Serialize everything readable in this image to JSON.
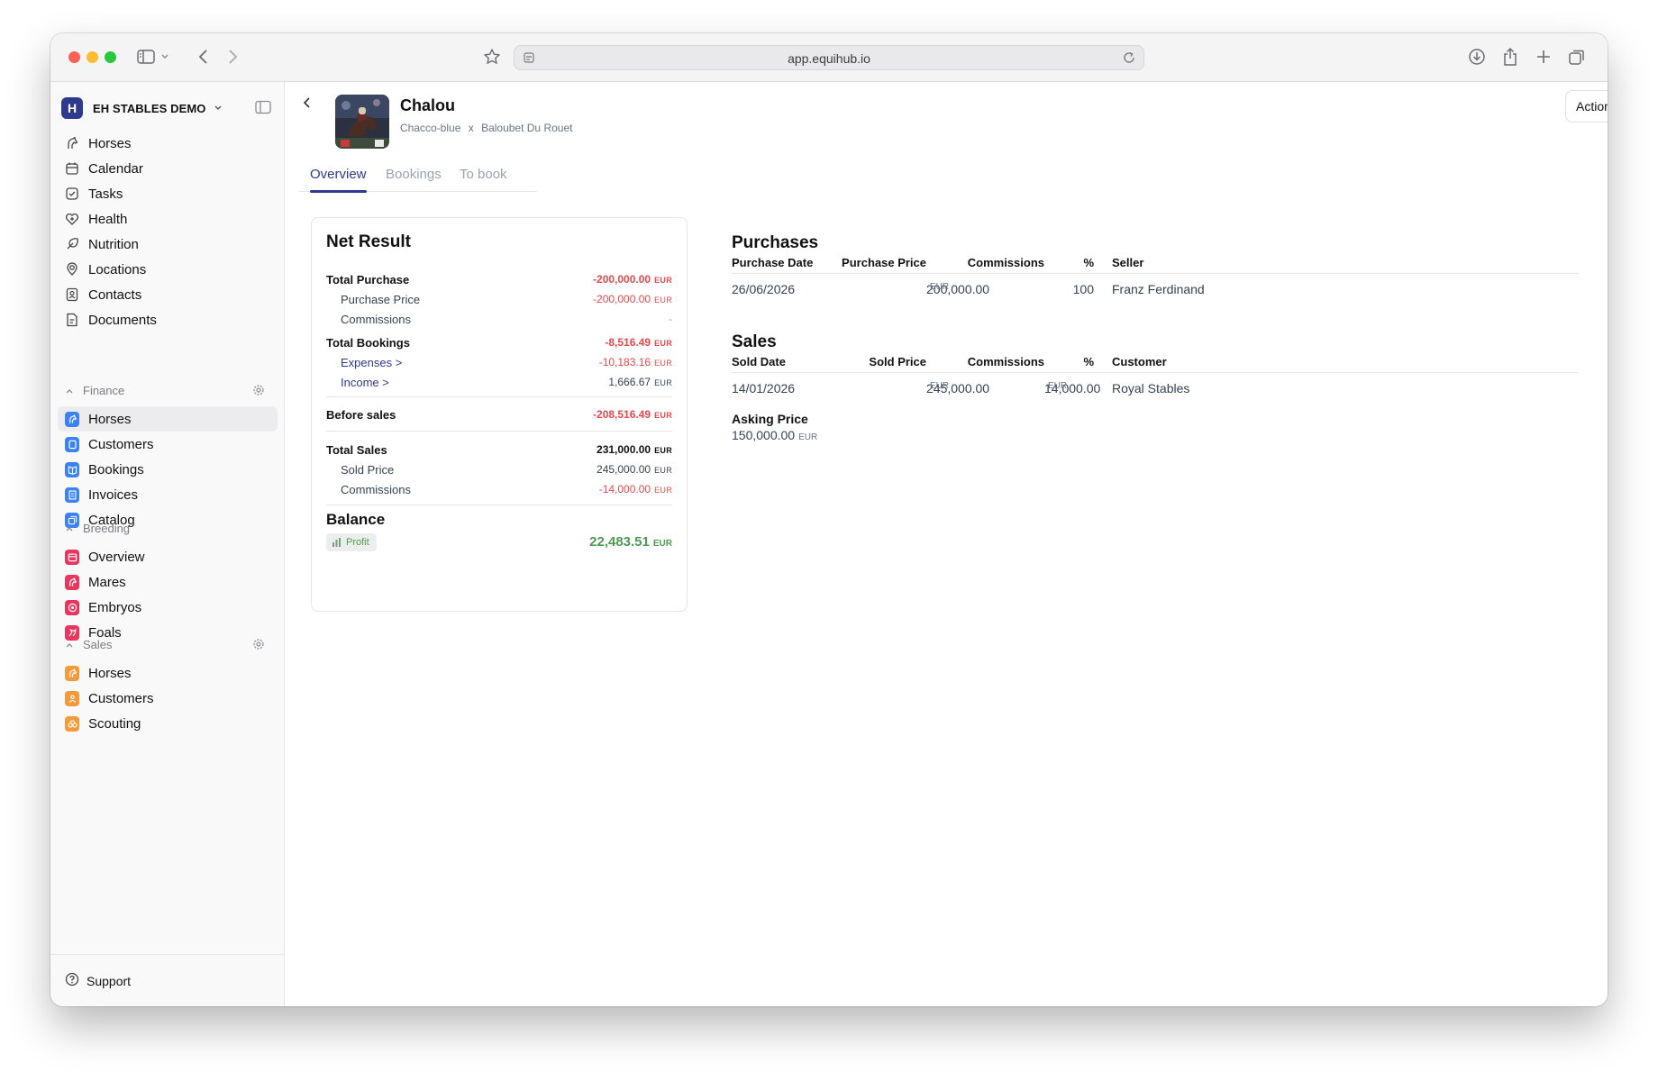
{
  "browser": {
    "url": "app.equihub.io"
  },
  "sidebar": {
    "workspace": "EH STABLES DEMO",
    "workspace_logo": "H",
    "main_items": [
      {
        "label": "Horses",
        "icon": "horse-icon"
      },
      {
        "label": "Calendar",
        "icon": "calendar-icon"
      },
      {
        "label": "Tasks",
        "icon": "checkbox-icon"
      },
      {
        "label": "Health",
        "icon": "health-icon"
      },
      {
        "label": "Nutrition",
        "icon": "nutrition-icon"
      },
      {
        "label": "Locations",
        "icon": "location-icon"
      },
      {
        "label": "Contacts",
        "icon": "contacts-icon"
      },
      {
        "label": "Documents",
        "icon": "document-icon"
      }
    ],
    "finance": {
      "title": "Finance",
      "items": [
        "Horses",
        "Customers",
        "Bookings",
        "Invoices",
        "Catalog"
      ],
      "color": "#3b82f6"
    },
    "breeding": {
      "title": "Breeding",
      "items": [
        "Overview",
        "Mares",
        "Embryos",
        "Foals"
      ],
      "color": "#e8365e"
    },
    "sales": {
      "title": "Sales",
      "items": [
        "Horses",
        "Customers",
        "Scouting"
      ],
      "color": "#f59a3b"
    },
    "support": "Support"
  },
  "horse": {
    "name": "Chalou",
    "sire": "Chacco-blue",
    "separator": "x",
    "dam": "Baloubet Du Rouet"
  },
  "header": {
    "actions_label": "Actions"
  },
  "tabs": [
    "Overview",
    "Bookings",
    "To book"
  ],
  "net_result": {
    "title": "Net Result",
    "currency": "EUR",
    "total_purchase": {
      "label": "Total Purchase",
      "value": "-200,000.00"
    },
    "purchase_price": {
      "label": "Purchase Price",
      "value": "-200,000.00"
    },
    "purchase_commissions": {
      "label": "Commissions",
      "value": "-"
    },
    "total_bookings": {
      "label": "Total Bookings",
      "value": "-8,516.49"
    },
    "expenses": {
      "label": "Expenses >",
      "value": "-10,183.16"
    },
    "income": {
      "label": "Income >",
      "value": "1,666.67"
    },
    "before_sales": {
      "label": "Before sales",
      "value": "-208,516.49"
    },
    "total_sales": {
      "label": "Total Sales",
      "value": "231,000.00"
    },
    "sold_price": {
      "label": "Sold Price",
      "value": "245,000.00"
    },
    "sales_commissions": {
      "label": "Commissions",
      "value": "-14,000.00"
    },
    "balance": {
      "label": "Balance",
      "badge": "Profit",
      "value": "22,483.51"
    }
  },
  "purchases": {
    "title": "Purchases",
    "columns": [
      "Purchase Date",
      "Purchase Price",
      "Commissions",
      "%",
      "Seller"
    ],
    "rows": [
      {
        "date": "26/06/2026",
        "price": "200,000.00",
        "currency": "EUR",
        "commissions": "",
        "percent": "100",
        "seller": "Franz Ferdinand"
      }
    ]
  },
  "sales_table": {
    "title": "Sales",
    "columns": [
      "Sold Date",
      "Sold Price",
      "Commissions",
      "%",
      "Customer"
    ],
    "rows": [
      {
        "date": "14/01/2026",
        "price": "245,000.00",
        "price_currency": "EUR",
        "commissions": "14,000.00",
        "commissions_currency": "EUR",
        "percent": "",
        "customer": "Royal Stables"
      }
    ]
  },
  "asking_price": {
    "label": "Asking Price",
    "value": "150,000.00",
    "currency": "EUR"
  },
  "colors": {
    "accent": "#2e3a8c",
    "negative": "#e5484d",
    "positive": "#4f9a51"
  }
}
